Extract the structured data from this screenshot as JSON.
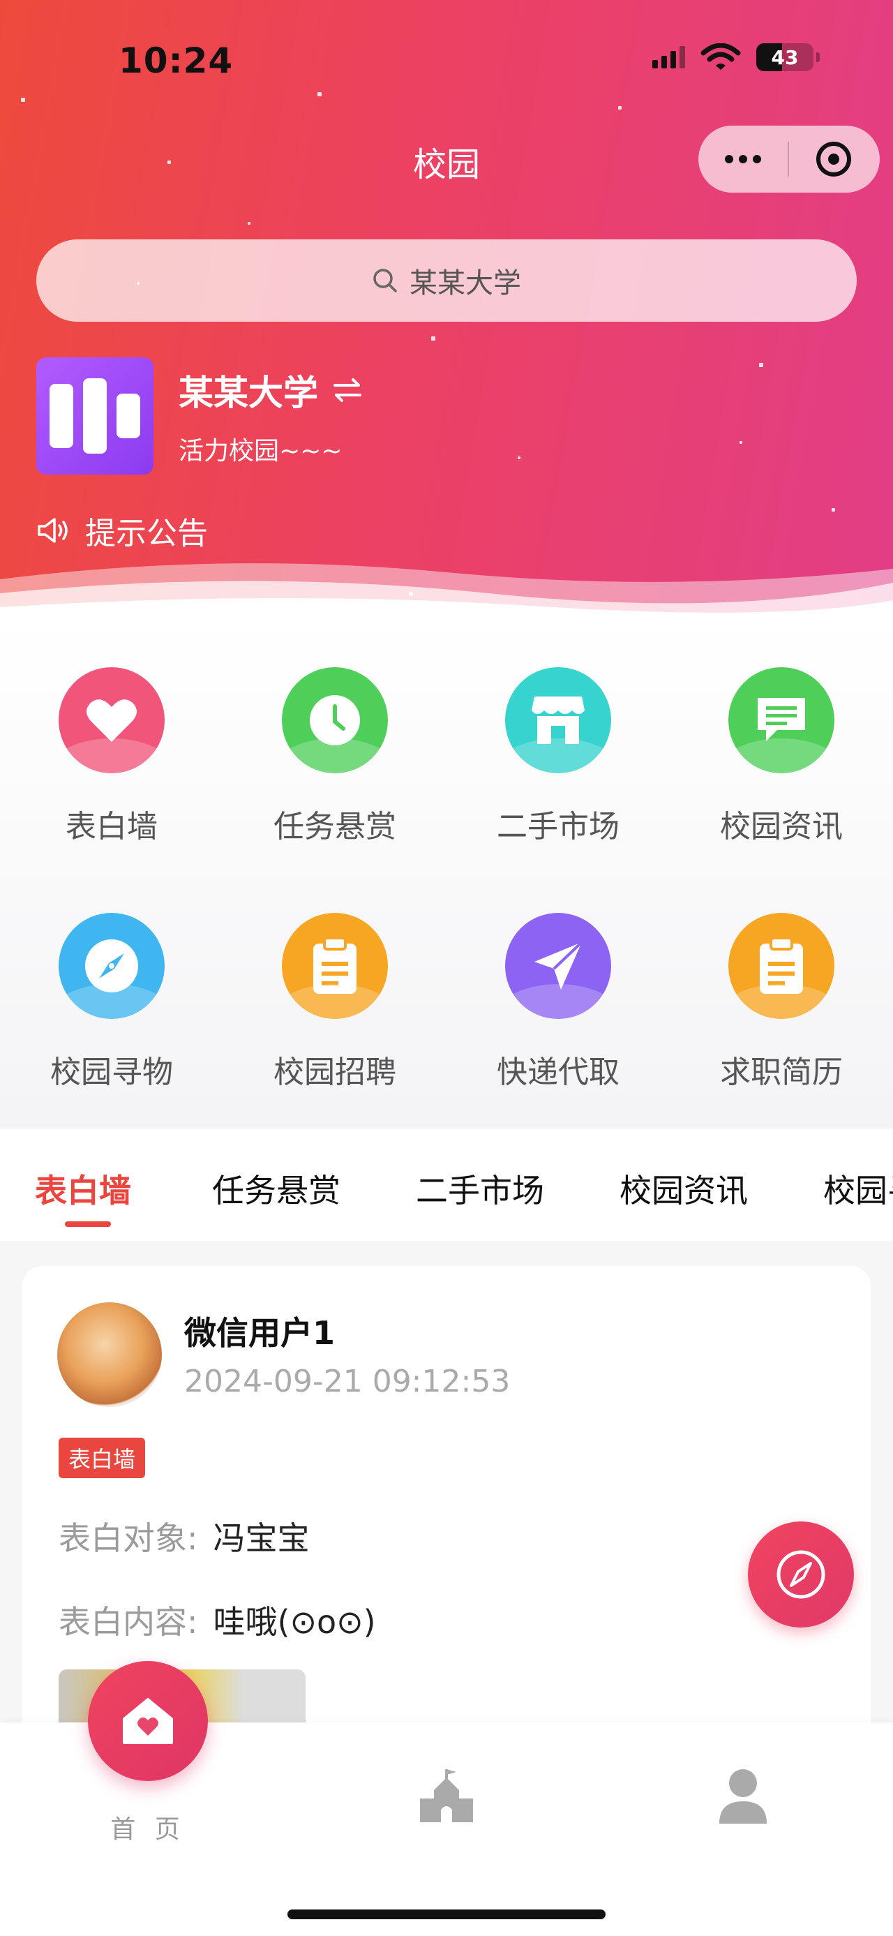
{
  "status_bar": {
    "time": "10:24",
    "battery": "43"
  },
  "header": {
    "title": "校园"
  },
  "search": {
    "placeholder": "某某大学"
  },
  "school": {
    "name": "某某大学",
    "motto": "活力校园~~~"
  },
  "notice": {
    "label": "提示公告"
  },
  "grid": [
    {
      "label": "表白墙",
      "icon": "heart-icon",
      "color": "#f2557a"
    },
    {
      "label": "任务悬赏",
      "icon": "clock-icon",
      "color": "#4fcf5a"
    },
    {
      "label": "二手市场",
      "icon": "store-icon",
      "color": "#37d3cf"
    },
    {
      "label": "校园资讯",
      "icon": "message-icon",
      "color": "#4fcf5a"
    },
    {
      "label": "校园寻物",
      "icon": "compass-icon",
      "color": "#3fb6f0"
    },
    {
      "label": "校园招聘",
      "icon": "clipboard-icon",
      "color": "#f6a623"
    },
    {
      "label": "快递代取",
      "icon": "paper-plane-icon",
      "color": "#8d63f3"
    },
    {
      "label": "求职简历",
      "icon": "clipboard-icon",
      "color": "#f6a623"
    }
  ],
  "tabs": [
    {
      "label": "表白墙",
      "active": true
    },
    {
      "label": "任务悬赏"
    },
    {
      "label": "二手市场"
    },
    {
      "label": "校园资讯"
    },
    {
      "label": "校园寻物"
    }
  ],
  "post": {
    "user": "微信用户1",
    "time": "2024-09-21 09:12:53",
    "tag": "表白墙",
    "target_label": "表白对象:",
    "target_value": "冯宝宝",
    "content_label": "表白内容:",
    "content_value": "哇哦(⊙o⊙)"
  },
  "bottom_nav": {
    "home_label": "首 页"
  },
  "colors": {
    "accent": "#e8463f",
    "brand_pink": "#e23e86"
  }
}
